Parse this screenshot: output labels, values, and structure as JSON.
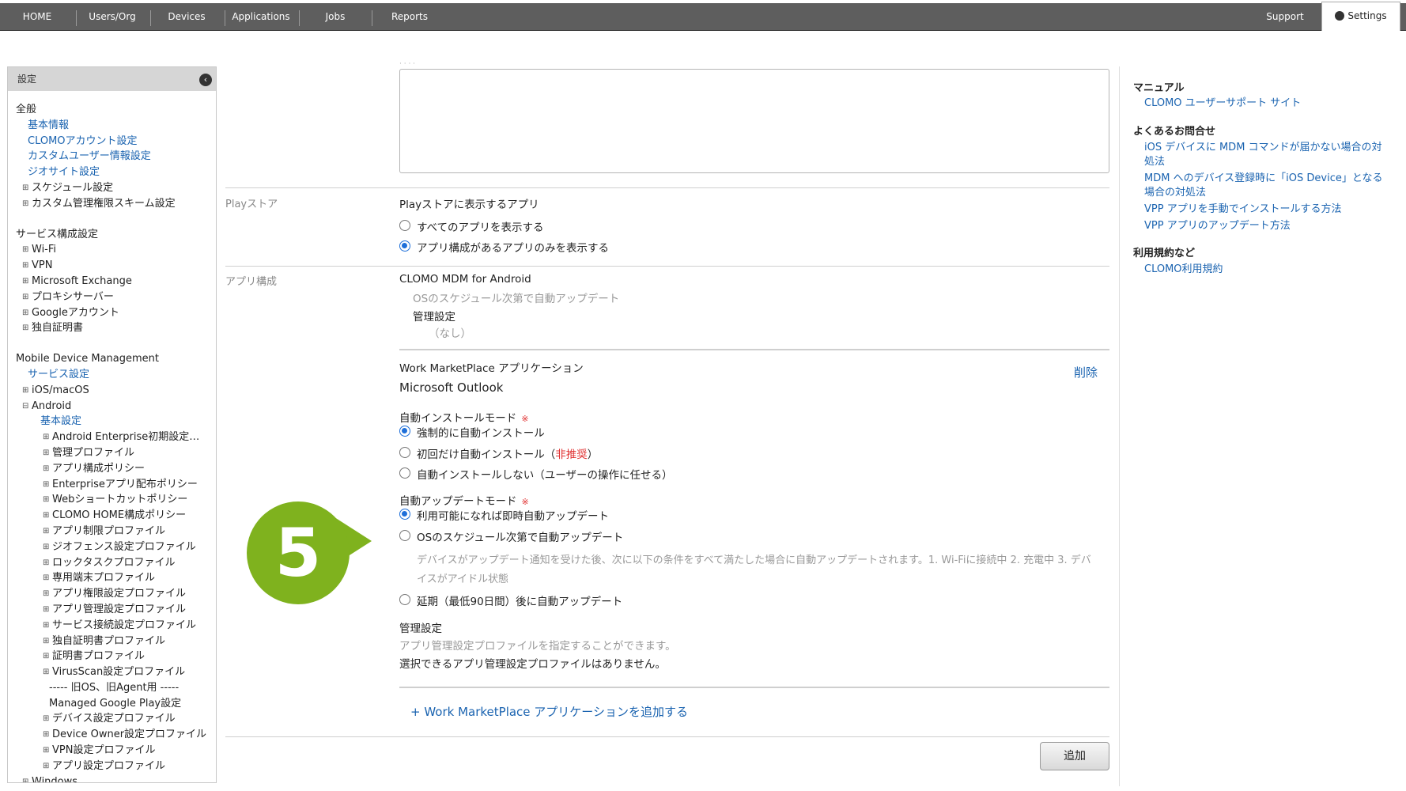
{
  "nav": {
    "items": [
      "HOME",
      "Users/Org",
      "Devices",
      "Applications",
      "Jobs",
      "Reports"
    ],
    "support": "Support",
    "settings": "Settings"
  },
  "sidebar": {
    "header": "設定",
    "general_title": "全般",
    "general_links": [
      "基本情報",
      "CLOMOアカウント設定",
      "カスタムユーザー情報設定",
      "ジオサイト設定"
    ],
    "general_toggles": [
      "スケジュール設定",
      "カスタム管理権限スキーム設定"
    ],
    "service_title": "サービス構成設定",
    "service_toggles": [
      "Wi-Fi",
      "VPN",
      "Microsoft Exchange",
      "プロキシサーバー",
      "Googleアカウント",
      "独自証明書"
    ],
    "mdm_title": "Mobile Device Management",
    "mdm_link": "サービス設定",
    "mdm_ios": "iOS/macOS",
    "mdm_android": "Android",
    "android_link": "基本設定",
    "android_items": [
      "Android Enterprise初期設定…",
      "管理プロファイル",
      "アプリ構成ポリシー",
      "Enterpriseアプリ配布ポリシー",
      "Webショートカットポリシー",
      "CLOMO HOME構成ポリシー",
      "アプリ制限プロファイル",
      "ジオフェンス設定プロファイル",
      "ロックタスクプロファイル",
      "専用端末プロファイル",
      "アプリ権限設定プロファイル",
      "アプリ管理設定プロファイル",
      "サービス接続設定プロファイル",
      "独自証明書プロファイル",
      "証明書プロファイル",
      "VirusScan設定プロファイル"
    ],
    "legacy": "----- 旧OS、旧Agent用 -----",
    "managed_gp": "Managed Google Play設定",
    "managed_items": [
      "デバイス設定プロファイル",
      "Device Owner設定プロファイル",
      "VPN設定プロファイル",
      "アプリ設定プロファイル"
    ],
    "windows": "Windows"
  },
  "main": {
    "playstore_label": "Playストア",
    "playstore_title": "Playストアに表示するアプリ",
    "playstore_opt1": "すべてのアプリを表示する",
    "playstore_opt2": "アプリ構成があるアプリのみを表示する",
    "appconfig_label": "アプリ構成",
    "clomo_app": "CLOMO MDM for Android",
    "clomo_update": "OSのスケジュール次第で自動アップデート",
    "mgmt_label": "管理設定",
    "mgmt_none": "（なし）",
    "wm_title": "Work MarketPlace アプリケーション",
    "delete": "削除",
    "app_name": "Microsoft Outlook",
    "install_mode": "自動インストールモード",
    "required_mark": "※",
    "install_opt1": "強制的に自動インストール",
    "install_opt2a": "初回だけ自動インストール（",
    "install_opt2b": "非推奨",
    "install_opt2c": "）",
    "install_opt3": "自動インストールしない（ユーザーの操作に任せる）",
    "update_mode": "自動アップデートモード",
    "update_opt1": "利用可能になれば即時自動アップデート",
    "update_opt2": "OSのスケジュール次第で自動アップデート",
    "update_desc1": "デバイスがアップデート通知を受けた後、次に以下の条件をすべて満たした場合に自動アップデートされます。1. Wi-Fiに接続中 2. 充電中 3. デバ",
    "update_desc2": "イスがアイドル状態",
    "update_opt3": "延期（最低90日間）後に自動アップデート",
    "mgmt2_label": "管理設定",
    "mgmt2_desc": "アプリ管理設定プロファイルを指定することができます。",
    "mgmt2_none": "選択できるアプリ管理設定プロファイルはありません。",
    "add_wm": "+ Work MarketPlace アプリケーションを追加する",
    "add_button": "追加",
    "badge": "5"
  },
  "right": {
    "manual_title": "マニュアル",
    "manual_link": "CLOMO ユーザーサポート サイト",
    "faq_title": "よくあるお問合せ",
    "faq1": "iOS デバイスに MDM コマンドが届かない場合の対処法",
    "faq2": "MDM へのデバイス登録時に「iOS Device」となる場合の対処法",
    "faq3": "VPP アプリを手動でインストールする方法",
    "faq4": "VPP アプリのアップデート方法",
    "terms_title": "利用規約など",
    "terms_link": "CLOMO利用規約"
  },
  "colors": {
    "nav": "#5e5e5e",
    "link": "#1a63b0",
    "badge": "#7fb21e",
    "radio": "#1e6fd9",
    "required": "#e03030"
  }
}
